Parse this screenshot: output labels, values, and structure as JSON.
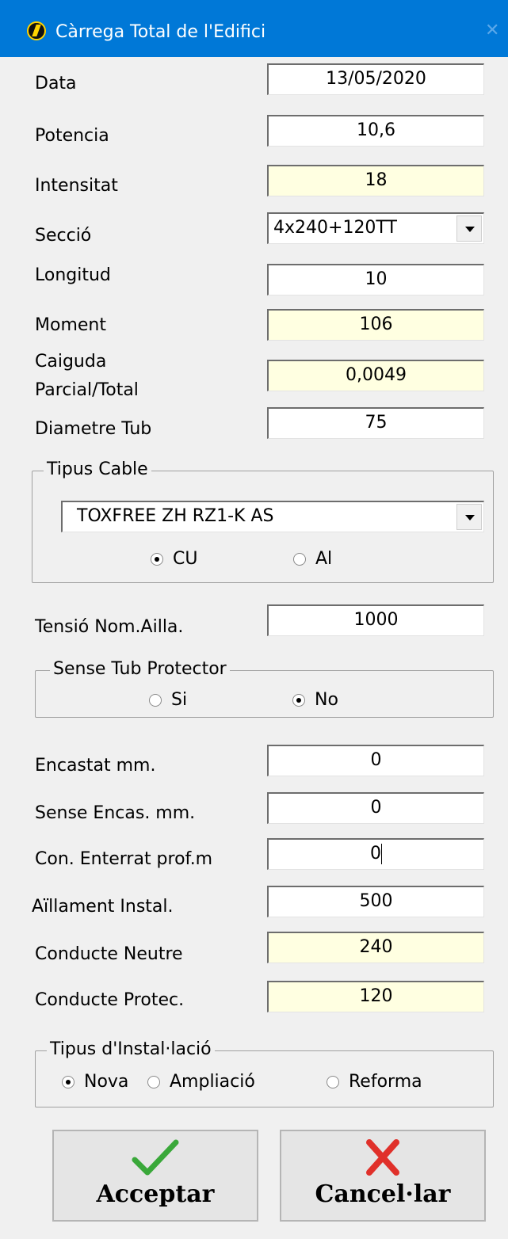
{
  "window": {
    "title": "Càrrega Total de l'Edifici",
    "close_glyph": "✕",
    "app_icon": "lightning-logo-icon"
  },
  "form": {
    "data": {
      "label": "Data",
      "value": "13/05/2020"
    },
    "potencia": {
      "label": "Potencia",
      "value": "10,6"
    },
    "intensitat": {
      "label": "Intensitat",
      "value": "18"
    },
    "seccio": {
      "label": "Secció",
      "value": "4x240+120TT"
    },
    "longitud": {
      "label": "Longitud",
      "value": "10"
    },
    "moment": {
      "label": "Moment",
      "value": "106"
    },
    "caiguda": {
      "label_line1": "Caiguda",
      "label_line2": "Parcial/Total",
      "value": "0,0049"
    },
    "diametre": {
      "label": "Diametre Tub",
      "value": "75"
    }
  },
  "tipus_cable": {
    "legend": "Tipus Cable",
    "selected": "TOXFREE ZH RZ1-K AS",
    "options": [
      {
        "label": "CU",
        "checked": true
      },
      {
        "label": "Al",
        "checked": false
      }
    ]
  },
  "tensio": {
    "label": "Tensió Nom.Ailla.",
    "value": "1000"
  },
  "sense_tub": {
    "legend": "Sense Tub Protector",
    "options": [
      {
        "label": "Si",
        "checked": false
      },
      {
        "label": "No",
        "checked": true
      }
    ]
  },
  "form2": {
    "encastat": {
      "label": "Encastat mm.",
      "value": "0"
    },
    "sense_encas": {
      "label": "Sense Encas. mm.",
      "value": "0"
    },
    "enterrat": {
      "label": "Con. Enterrat prof.m",
      "value": "0"
    },
    "aillament": {
      "label": "Aïllament Instal.",
      "value": "500"
    },
    "neutre": {
      "label": "Conducte Neutre",
      "value": "240"
    },
    "protec": {
      "label": "Conducte Protec.",
      "value": "120"
    }
  },
  "tipus_installacio": {
    "legend": "Tipus d'Instal·lació",
    "options": [
      {
        "label": "Nova",
        "checked": true
      },
      {
        "label": "Ampliació",
        "checked": false
      },
      {
        "label": "Reforma",
        "checked": false
      }
    ]
  },
  "buttons": {
    "accept": "Acceptar",
    "cancel": "Cancel·lar"
  },
  "colors": {
    "titlebar": "#0078d7",
    "readonly_field": "#ffffe1",
    "accept_icon": "#3aa83a",
    "cancel_icon": "#e0302a"
  }
}
